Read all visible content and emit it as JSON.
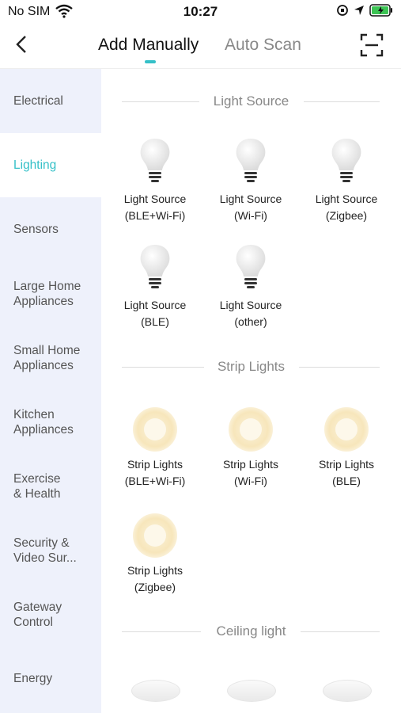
{
  "status": {
    "carrier": "No SIM",
    "time": "10:27"
  },
  "nav": {
    "tab_active": "Add Manually",
    "tab_inactive": "Auto Scan"
  },
  "sidebar": {
    "items": [
      {
        "label": "Electrical"
      },
      {
        "label": "Lighting"
      },
      {
        "label": "Sensors"
      },
      {
        "label": "Large Home Appliances"
      },
      {
        "label": "Small Home Appliances"
      },
      {
        "label": "Kitchen Appliances"
      },
      {
        "label": "Exercise & Health"
      },
      {
        "label": "Security & Video Sur..."
      },
      {
        "label": "Gateway Control"
      },
      {
        "label": "Energy"
      }
    ]
  },
  "sections": [
    {
      "title": "Light Source",
      "devices": [
        {
          "line1": "Light Source",
          "line2": "(BLE+Wi-Fi)"
        },
        {
          "line1": "Light Source",
          "line2": "(Wi-Fi)"
        },
        {
          "line1": "Light Source",
          "line2": "(Zigbee)"
        },
        {
          "line1": "Light Source",
          "line2": "(BLE)"
        },
        {
          "line1": "Light Source",
          "line2": "(other)"
        }
      ]
    },
    {
      "title": "Strip Lights",
      "devices": [
        {
          "line1": "Strip Lights",
          "line2": "(BLE+Wi-Fi)"
        },
        {
          "line1": "Strip Lights",
          "line2": "(Wi-Fi)"
        },
        {
          "line1": "Strip Lights",
          "line2": "(BLE)"
        },
        {
          "line1": "Strip Lights",
          "line2": "(Zigbee)"
        }
      ]
    },
    {
      "title": "Ceiling light",
      "devices": []
    }
  ],
  "colors": {
    "accent": "#35c0c8",
    "sidebar_bg": "#eef1fb"
  }
}
